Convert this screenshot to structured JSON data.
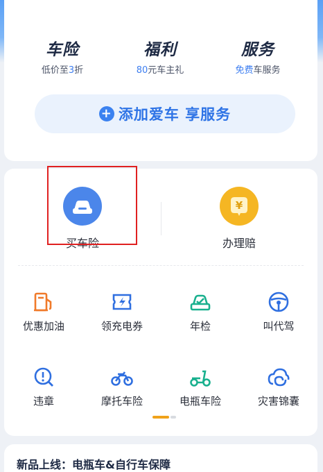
{
  "benefits": [
    {
      "title": "车险",
      "sub_pre": "低价至",
      "sub_hl": "3",
      "sub_post": "折"
    },
    {
      "title": "福利",
      "sub_pre": "",
      "sub_hl": "80",
      "sub_post": "元车主礼"
    },
    {
      "title": "服务",
      "sub_pre": "",
      "sub_hl": "免费",
      "sub_post": "车服务"
    }
  ],
  "add_car": {
    "label": "添加爱车 享服务",
    "icon": "plus-circle-icon"
  },
  "main_services": [
    {
      "label": "买车险",
      "icon": "car-icon",
      "color": "#4b86ea"
    },
    {
      "label": "办理赔",
      "icon": "yen-coin-icon",
      "color": "#f5b623"
    }
  ],
  "grid_row1": [
    {
      "label": "优惠加油",
      "icon": "fuel-pump-icon",
      "color": "#f07a2a"
    },
    {
      "label": "领充电券",
      "icon": "charging-icon",
      "color": "#2f6fe0"
    },
    {
      "label": "年检",
      "icon": "inspection-car-icon",
      "color": "#19b08e"
    },
    {
      "label": "叫代驾",
      "icon": "steering-wheel-icon",
      "color": "#2f6fe0"
    }
  ],
  "grid_row2": [
    {
      "label": "违章",
      "icon": "violation-search-icon",
      "color": "#2f6fe0"
    },
    {
      "label": "摩托车险",
      "icon": "motorcycle-icon",
      "color": "#2f6fe0"
    },
    {
      "label": "电瓶车险",
      "icon": "scooter-icon",
      "color": "#19b08e"
    },
    {
      "label": "灾害锦囊",
      "icon": "disaster-bag-icon",
      "color": "#2f6fe0"
    }
  ],
  "news": {
    "title": "新品上线：电瓶车&自行车保障"
  }
}
